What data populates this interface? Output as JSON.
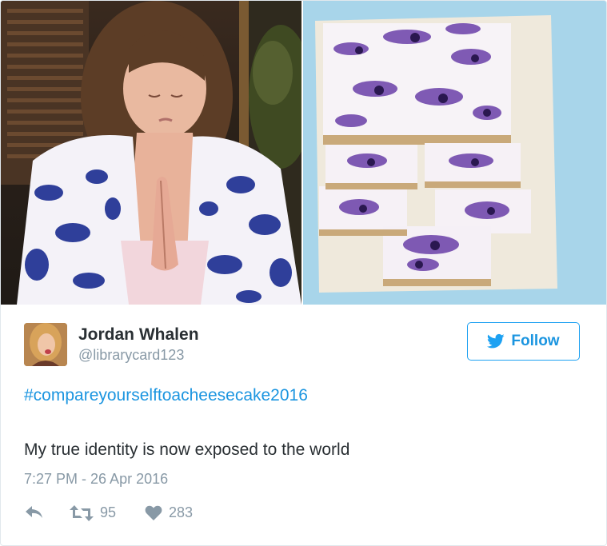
{
  "tweet": {
    "author": {
      "display_name": "Jordan Whalen",
      "handle": "@librarycard123",
      "avatar_icon": "user-avatar"
    },
    "follow_label": "Follow",
    "hashtag": "#compareyourselftoacheesecake2016",
    "text": "My true identity is now exposed to the world",
    "timestamp": "7:27 PM - 26 Apr 2016",
    "actions": {
      "reply_icon": "reply-icon",
      "retweet_icon": "retweet-icon",
      "retweet_count": "95",
      "like_icon": "heart-icon",
      "like_count": "283"
    }
  },
  "colors": {
    "accent": "#1b95e0",
    "text": "#292f33",
    "muted": "#8899a6",
    "border": "#e1e8ed"
  }
}
